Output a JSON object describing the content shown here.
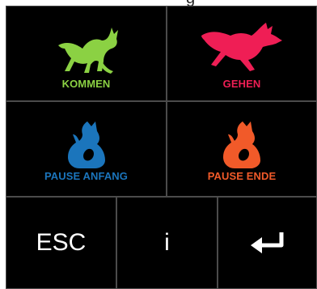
{
  "header": {
    "cut_text": "g"
  },
  "actions": {
    "kommen": {
      "label": "KOMMEN",
      "color": "#8bd143"
    },
    "gehen": {
      "label": "GEHEN",
      "color": "#ef1e55"
    },
    "pause_anfang": {
      "label": "PAUSE ANFANG",
      "color": "#1b75bc"
    },
    "pause_ende": {
      "label": "PAUSE ENDE",
      "color": "#f15a29"
    }
  },
  "keys": {
    "esc": "ESC",
    "info": "i",
    "enter_icon": "enter-arrow-icon"
  }
}
